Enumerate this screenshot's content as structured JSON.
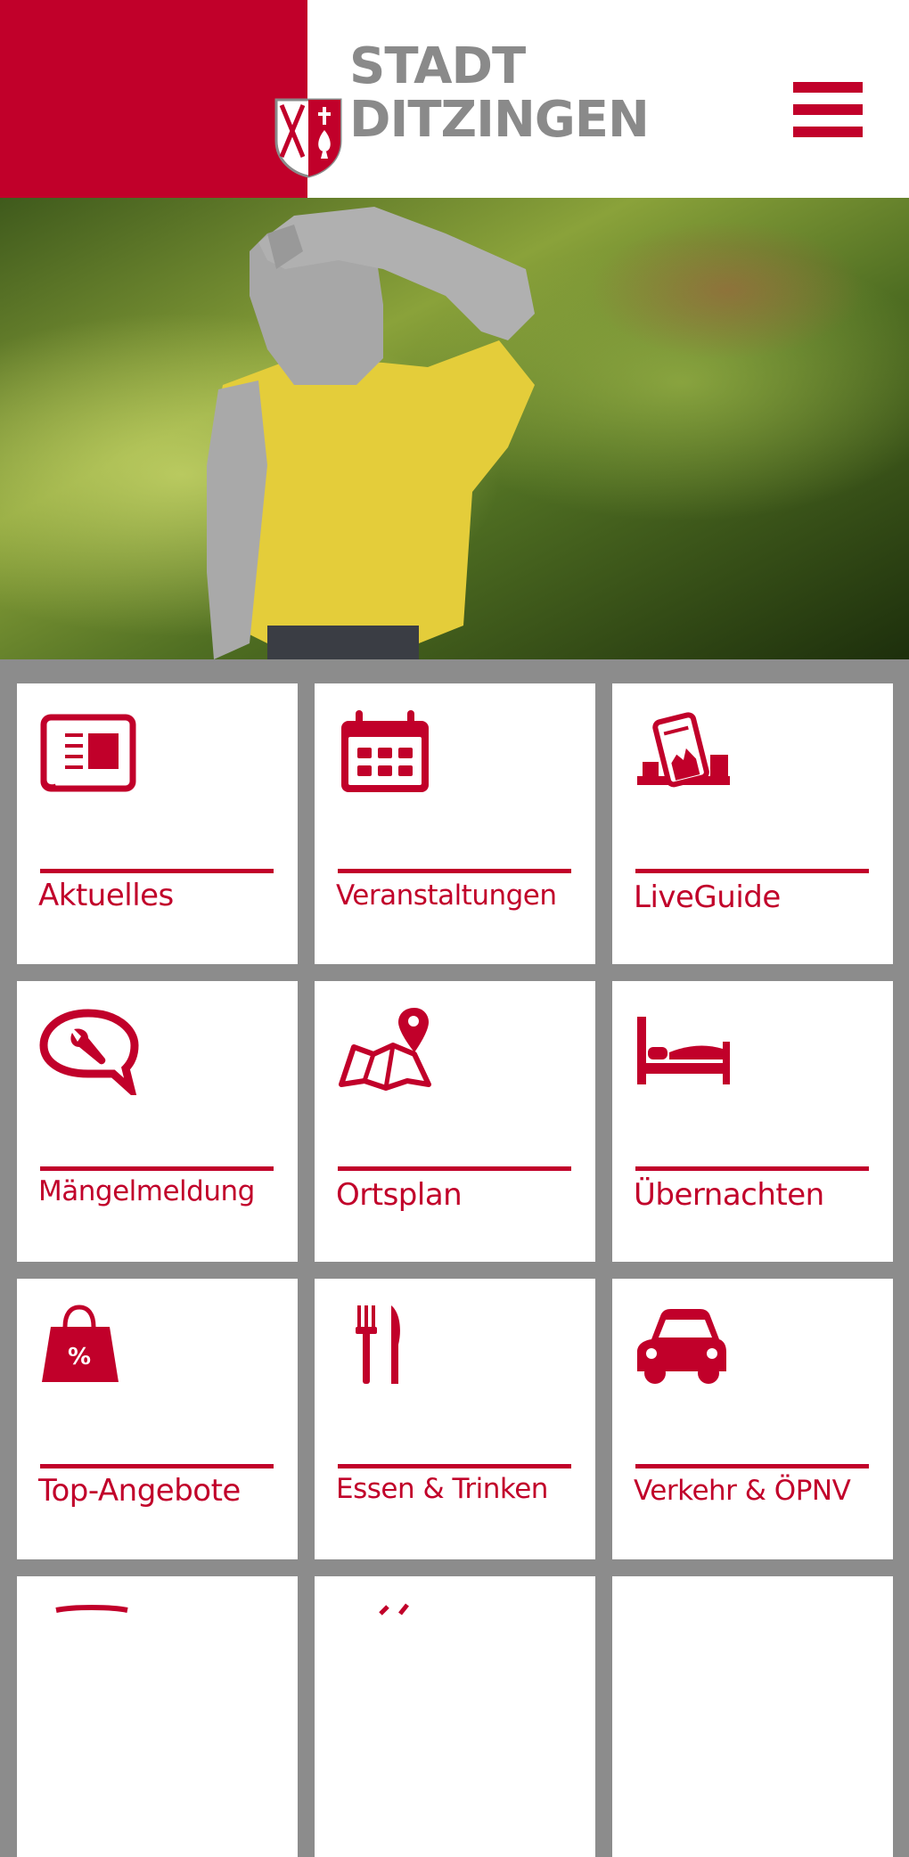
{
  "header": {
    "brand_line1": "STADT",
    "brand_line2": "DITZINGEN",
    "menu_icon": "hamburger-menu-icon",
    "colors": {
      "brand_red": "#c1002a",
      "brand_grey": "#8a8a8a"
    }
  },
  "hero": {
    "image": "wooden-figure-statue-photo"
  },
  "tiles": [
    {
      "label": "Aktuelles",
      "icon": "newspaper-icon"
    },
    {
      "label": "Veranstaltungen",
      "icon": "calendar-icon"
    },
    {
      "label": "LiveGuide",
      "icon": "live-guide-icon"
    },
    {
      "label": "Mängelmeldung",
      "icon": "wrench-speech-bubble-icon"
    },
    {
      "label": "Ortsplan",
      "icon": "map-pin-icon"
    },
    {
      "label": "Übernachten",
      "icon": "bed-icon"
    },
    {
      "label": "Top-Angebote",
      "icon": "shopping-bag-percent-icon"
    },
    {
      "label": "Essen & Trinken",
      "icon": "fork-knife-icon"
    },
    {
      "label": "Verkehr & ÖPNV",
      "icon": "car-icon"
    }
  ]
}
